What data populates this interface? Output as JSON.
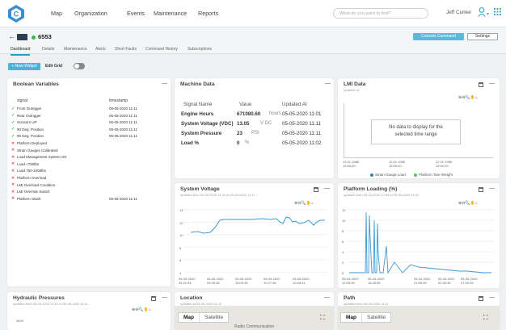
{
  "nav": {
    "items": [
      "Map",
      "Organization",
      "Events",
      "Maintenance",
      "Reports"
    ],
    "search_placeholder": "What do you want to find?",
    "user_name": "Jeff Curlee"
  },
  "device": {
    "name": "6553",
    "console_label": "Console Command",
    "settings_label": "Settings"
  },
  "tabs": [
    "Dashboard",
    "Details",
    "Maintenance",
    "Alerts",
    "Short Faults",
    "Command History",
    "Subscriptions"
  ],
  "toolbar": {
    "new_widget": "+ New Widget",
    "edit_grid": "Edit Grid"
  },
  "boolean_variables": {
    "title": "Boolean Variables",
    "headers": [
      "signal",
      "timestamp"
    ],
    "rows": [
      {
        "signal": "Front Outrigger",
        "ts": "05-05-2020 11:11",
        "state": "true"
      },
      {
        "signal": "Rear Outrigger",
        "ts": "05-05-2020 11:11",
        "state": "true"
      },
      {
        "signal": "Scissors UP",
        "ts": "05-05-2020 11:11",
        "state": "true"
      },
      {
        "signal": "90 Deg. Position",
        "ts": "05-05-2020 11:11",
        "state": "true"
      },
      {
        "signal": "90 Deg. Position",
        "ts": "05-05-2020 11:11",
        "state": "true"
      },
      {
        "signal": "Platform Deployed",
        "ts": "",
        "state": "false"
      },
      {
        "signal": "Strain Gauges Calibrated",
        "ts": "",
        "state": "false"
      },
      {
        "signal": "Load Management System OK",
        "ts": "",
        "state": "false"
      },
      {
        "signal": "Load <750lbs",
        "ts": "",
        "state": "false"
      },
      {
        "signal": "Load 750-1000lbs",
        "ts": "",
        "state": "false"
      },
      {
        "signal": "Platform Overload",
        "ts": "",
        "state": "false"
      },
      {
        "signal": "LMI Overload Condition",
        "ts": "",
        "state": "false"
      },
      {
        "signal": "LMI Override Switch",
        "ts": "",
        "state": "false"
      },
      {
        "signal": "Platform Stash",
        "ts": "05-05-2020 11:11",
        "state": "false"
      }
    ]
  },
  "machine_data": {
    "title": "Machine Data",
    "headers": [
      "Signal Name",
      "Value",
      "Updated At"
    ],
    "rows": [
      {
        "name": "Engine Hours",
        "value": "671080.60",
        "unit": "hours",
        "ts": "05-05-2020 11:01"
      },
      {
        "name": "System Voltage (VDC)",
        "value": "13.05",
        "unit": "V DC",
        "ts": "05-05-2020 11:11"
      },
      {
        "name": "System Pressure",
        "value": "23",
        "unit": "PSI",
        "ts": "05-05-2020 11:11"
      },
      {
        "name": "Load %",
        "value": "0",
        "unit": "%",
        "ts": "05-05-2020 11:02"
      }
    ]
  },
  "lmi_data": {
    "title": "LMI Data",
    "subtitle": "updated at",
    "nodata_line1": "No data to display for the",
    "nodata_line2": "selected time range",
    "x_ticks": [
      [
        "12.01.1986",
        "19:00:00"
      ],
      [
        "12.01.1986",
        "19:00:00"
      ],
      [
        "12.01.1986",
        "19:00:00"
      ]
    ],
    "legend": [
      {
        "label": "Strain Gauge Load",
        "color": "#2d7fb8"
      },
      {
        "label": "Platform Tare Weight",
        "color": "#5bbf6a"
      }
    ]
  },
  "system_voltage": {
    "title": "System Voltage",
    "subtitle": "updated from 05-05-2020 21:11 to 05-05-2020 11:11",
    "y_ticks": [
      "14",
      "12",
      "10",
      "8",
      "6",
      "4"
    ],
    "x_ticks": [
      [
        "05-05-2020",
        "09:21:54"
      ],
      [
        "05-05-2020",
        "09:45:36"
      ],
      [
        "05-05-2020",
        "10:05:36"
      ],
      [
        "05-05-2020",
        "10:27:36"
      ],
      [
        "05-05-2020",
        "10:48:41"
      ]
    ]
  },
  "platform_loading": {
    "title": "Platform Loading (%)",
    "subtitle": "updated from 05-04-2020 12:59 to 05-05-2020 11:02",
    "y_ticks": [
      "12",
      "10",
      "8",
      "6",
      "4",
      "2",
      "0"
    ],
    "x_ticks": [
      [
        "05-04-2020",
        "12:05:35"
      ],
      [
        "05-04-2020",
        "16:45:55"
      ],
      [
        "05-04-2020",
        "21:55:35"
      ],
      [
        "05-05-2020",
        "02:45:36"
      ],
      [
        "05-05-2020",
        "07:05:35"
      ]
    ]
  },
  "hydraulic": {
    "title": "Hydraulic Pressures",
    "subtitle": "updated from 05-04-2020 14:51 to 05-05-2020 11:11",
    "first_tick": "3400"
  },
  "location": {
    "title": "Location",
    "subtitle": "updated at 05-05-2020 11:11",
    "map_label": "Map",
    "satellite_label": "Satellite",
    "street": "Radio Communication"
  },
  "path": {
    "title": "Path",
    "subtitle": "updated from 05-04-2020 11:11",
    "map_label": "Map",
    "satellite_label": "Satellite"
  },
  "colors": {
    "accent": "#4db2d4",
    "ok": "#3bb54a",
    "bad": "#d9534f",
    "line": "#3a9ad4"
  }
}
